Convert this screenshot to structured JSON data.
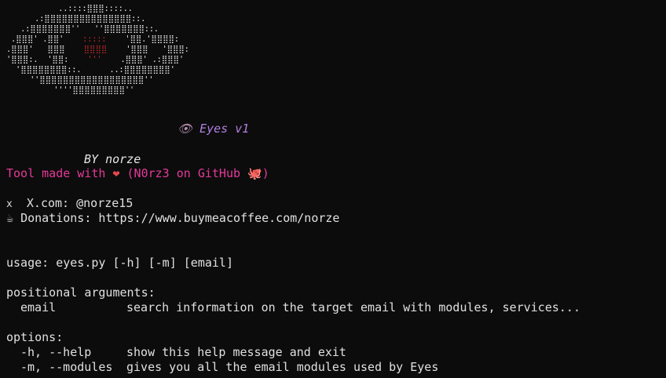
{
  "banner": {
    "eye_icon": "👁",
    "title": "Eyes v1",
    "byline": "BY norze"
  },
  "credits": {
    "prefix": "Tool made with ",
    "heart": "❤",
    "handle_text": " (N0rz3 on GitHub ",
    "octopus": "🐙",
    "close_paren": ")"
  },
  "social": {
    "x_icon": "x",
    "x_label": "X.com: @norze15",
    "coffee_icon": "☕",
    "donations_label": "Donations: https://www.buymeacoffee.com/norze"
  },
  "help": {
    "usage": "usage: eyes.py [-h] [-m] [email]",
    "positional_header": "positional arguments:",
    "positional_args": [
      {
        "name": "email",
        "description": "search information on the target email with modules, services..."
      }
    ],
    "options_header": "options:",
    "options": [
      {
        "flags": "-h, --help",
        "description": "show this help message and exit"
      },
      {
        "flags": "-m, --modules",
        "description": "gives you all the email modules used by Eyes"
      }
    ]
  },
  "colors": {
    "background": "#0c0c0c",
    "accent_pink": "#e5399a",
    "title_purple": "#b17fe0",
    "iris_red": "#c0272d"
  }
}
